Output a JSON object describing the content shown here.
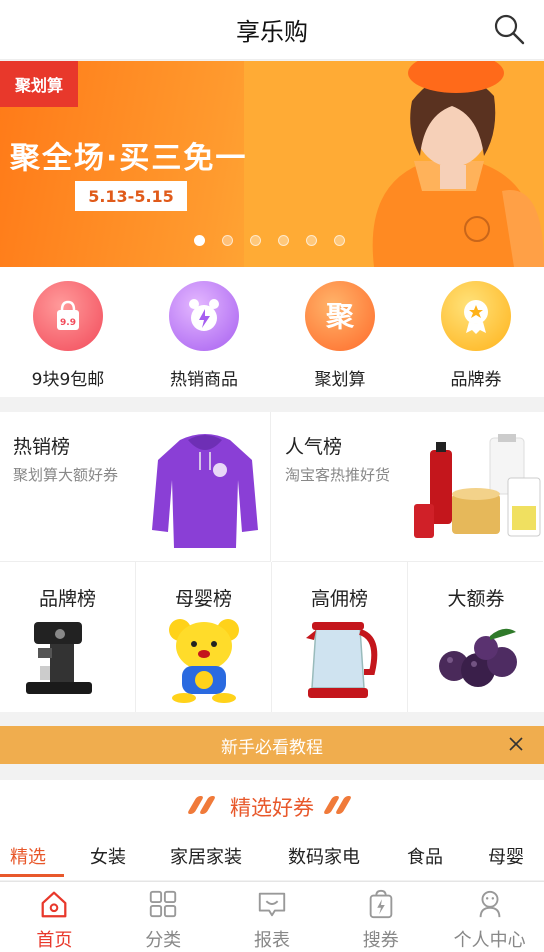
{
  "header": {
    "title": "享乐购"
  },
  "banner": {
    "tag": "聚划算",
    "headline": "聚全场·买三免一",
    "date": "5.13-5.15",
    "dots_total": 6,
    "dots_active": 1
  },
  "quick_links": [
    {
      "label": "9块9包邮",
      "icon": "bag-icon",
      "badge": "9.9"
    },
    {
      "label": "热销商品",
      "icon": "alarm-clock-icon"
    },
    {
      "label": "聚划算",
      "icon": "ju-icon",
      "badge": "聚"
    },
    {
      "label": "品牌券",
      "icon": "medal-icon"
    }
  ],
  "rank_boards": {
    "hot": {
      "title": "热销榜",
      "subtitle": "聚划算大额好券"
    },
    "popular": {
      "title": "人气榜",
      "subtitle": "淘宝客热推好货"
    },
    "small": [
      {
        "title": "品牌榜"
      },
      {
        "title": "母婴榜"
      },
      {
        "title": "高佣榜"
      },
      {
        "title": "大额券"
      }
    ]
  },
  "tutorial": {
    "label": "新手必看教程"
  },
  "picks": {
    "title": "精选好券",
    "tabs": [
      "精选",
      "女装",
      "家居家装",
      "数码家电",
      "食品",
      "母婴"
    ],
    "active_tab": 0
  },
  "bottom_nav": [
    {
      "label": "首页",
      "icon": "home-icon",
      "active": true
    },
    {
      "label": "分类",
      "icon": "category-icon"
    },
    {
      "label": "报表",
      "icon": "report-icon"
    },
    {
      "label": "搜券",
      "icon": "coupon-search-icon"
    },
    {
      "label": "个人中心",
      "icon": "profile-icon"
    }
  ],
  "colors": {
    "accent": "#e8582b",
    "tutorial_bar": "#f0ad4e",
    "banner": "#ff9a2e"
  }
}
